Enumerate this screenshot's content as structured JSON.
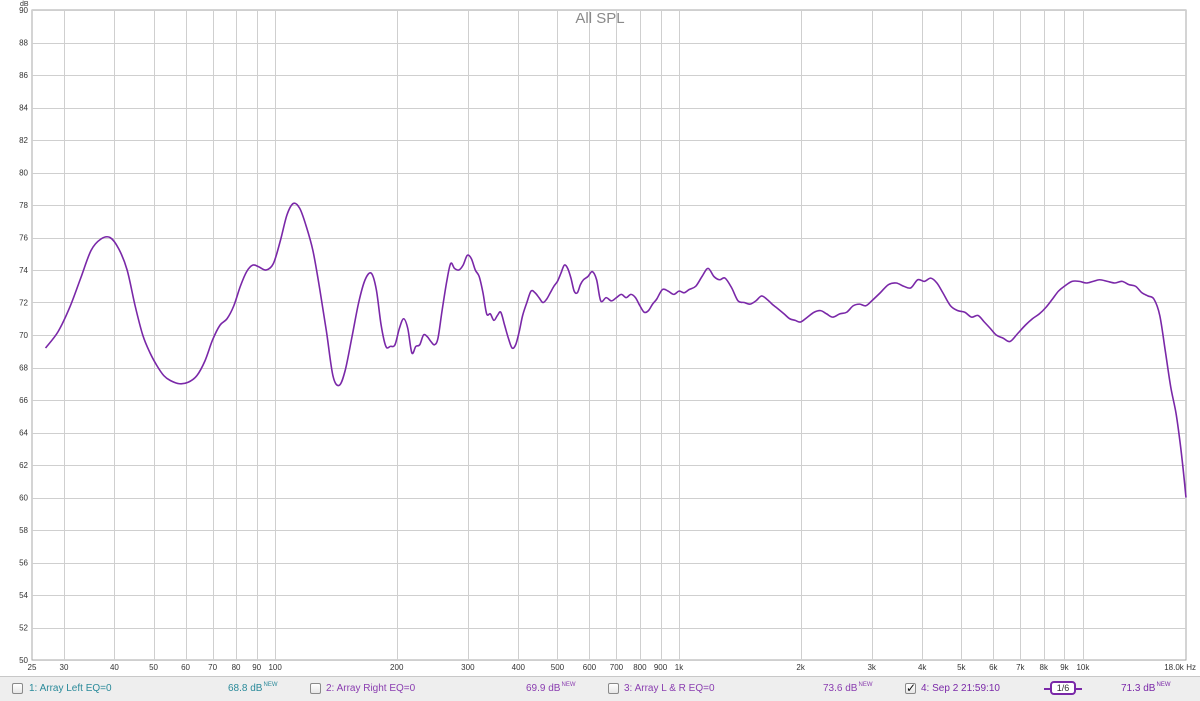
{
  "chart_data": {
    "type": "line",
    "title": "All SPL",
    "ylabel_unit": "dB",
    "xlabel_unit": "Hz",
    "x_scale": "log",
    "xlim": [
      25,
      18000
    ],
    "ylim": [
      50,
      90
    ],
    "y_ticks": [
      50,
      52,
      54,
      56,
      58,
      60,
      62,
      64,
      66,
      68,
      70,
      72,
      74,
      76,
      78,
      80,
      82,
      84,
      86,
      88,
      90
    ],
    "x_ticks": [
      {
        "v": 25,
        "label": "25"
      },
      {
        "v": 30,
        "label": "30"
      },
      {
        "v": 40,
        "label": "40"
      },
      {
        "v": 50,
        "label": "50"
      },
      {
        "v": 60,
        "label": "60"
      },
      {
        "v": 70,
        "label": "70"
      },
      {
        "v": 80,
        "label": "80"
      },
      {
        "v": 90,
        "label": "90"
      },
      {
        "v": 100,
        "label": "100"
      },
      {
        "v": 200,
        "label": "200"
      },
      {
        "v": 300,
        "label": "300"
      },
      {
        "v": 400,
        "label": "400"
      },
      {
        "v": 500,
        "label": "500"
      },
      {
        "v": 600,
        "label": "600"
      },
      {
        "v": 700,
        "label": "700"
      },
      {
        "v": 800,
        "label": "800"
      },
      {
        "v": 900,
        "label": "900"
      },
      {
        "v": 1000,
        "label": "1k"
      },
      {
        "v": 2000,
        "label": "2k"
      },
      {
        "v": 3000,
        "label": "3k"
      },
      {
        "v": 4000,
        "label": "4k"
      },
      {
        "v": 5000,
        "label": "5k"
      },
      {
        "v": 6000,
        "label": "6k"
      },
      {
        "v": 7000,
        "label": "7k"
      },
      {
        "v": 8000,
        "label": "8k"
      },
      {
        "v": 9000,
        "label": "9k"
      },
      {
        "v": 10000,
        "label": "10k"
      },
      {
        "v": 18000,
        "label": "18.0k"
      }
    ],
    "grid": true,
    "series": [
      {
        "name": "4: Sep 2 21:59:10",
        "color": "#7a28a8",
        "points": [
          [
            27,
            69.2
          ],
          [
            29,
            70.2
          ],
          [
            31,
            71.7
          ],
          [
            33,
            73.5
          ],
          [
            35,
            75.2
          ],
          [
            37,
            75.9
          ],
          [
            39,
            76.0
          ],
          [
            41,
            75.3
          ],
          [
            43,
            74.0
          ],
          [
            45,
            71.8
          ],
          [
            47,
            70.0
          ],
          [
            49,
            68.9
          ],
          [
            51,
            68.1
          ],
          [
            53,
            67.5
          ],
          [
            55,
            67.2
          ],
          [
            58,
            67.0
          ],
          [
            61,
            67.1
          ],
          [
            64,
            67.5
          ],
          [
            67,
            68.4
          ],
          [
            70,
            69.7
          ],
          [
            73,
            70.6
          ],
          [
            76,
            71.0
          ],
          [
            79,
            71.8
          ],
          [
            82,
            73.0
          ],
          [
            85,
            73.9
          ],
          [
            88,
            74.3
          ],
          [
            91,
            74.2
          ],
          [
            95,
            74.0
          ],
          [
            99,
            74.4
          ],
          [
            103,
            75.8
          ],
          [
            107,
            77.4
          ],
          [
            111,
            78.1
          ],
          [
            115,
            77.8
          ],
          [
            119,
            76.8
          ],
          [
            124,
            75.2
          ],
          [
            129,
            72.8
          ],
          [
            134,
            70.2
          ],
          [
            139,
            67.5
          ],
          [
            144,
            66.9
          ],
          [
            149,
            67.8
          ],
          [
            155,
            69.9
          ],
          [
            161,
            72.0
          ],
          [
            167,
            73.4
          ],
          [
            173,
            73.8
          ],
          [
            178,
            72.8
          ],
          [
            183,
            70.6
          ],
          [
            188,
            69.3
          ],
          [
            193,
            69.3
          ],
          [
            198,
            69.4
          ],
          [
            203,
            70.4
          ],
          [
            208,
            71.0
          ],
          [
            213,
            70.4
          ],
          [
            218,
            68.9
          ],
          [
            223,
            69.3
          ],
          [
            228,
            69.4
          ],
          [
            233,
            70.0
          ],
          [
            238,
            69.9
          ],
          [
            243,
            69.6
          ],
          [
            248,
            69.4
          ],
          [
            253,
            69.8
          ],
          [
            259,
            71.5
          ],
          [
            266,
            73.3
          ],
          [
            272,
            74.4
          ],
          [
            278,
            74.1
          ],
          [
            285,
            74.0
          ],
          [
            292,
            74.3
          ],
          [
            299,
            74.9
          ],
          [
            306,
            74.7
          ],
          [
            313,
            74.0
          ],
          [
            320,
            73.6
          ],
          [
            327,
            72.6
          ],
          [
            334,
            71.3
          ],
          [
            341,
            71.3
          ],
          [
            348,
            70.9
          ],
          [
            355,
            71.2
          ],
          [
            362,
            71.4
          ],
          [
            370,
            70.6
          ],
          [
            378,
            69.8
          ],
          [
            386,
            69.2
          ],
          [
            394,
            69.4
          ],
          [
            402,
            70.2
          ],
          [
            410,
            71.2
          ],
          [
            420,
            72.0
          ],
          [
            430,
            72.7
          ],
          [
            440,
            72.6
          ],
          [
            450,
            72.3
          ],
          [
            460,
            72.0
          ],
          [
            470,
            72.2
          ],
          [
            480,
            72.6
          ],
          [
            490,
            73.0
          ],
          [
            500,
            73.3
          ],
          [
            510,
            73.8
          ],
          [
            520,
            74.3
          ],
          [
            530,
            74.1
          ],
          [
            540,
            73.5
          ],
          [
            550,
            72.7
          ],
          [
            560,
            72.6
          ],
          [
            570,
            73.1
          ],
          [
            580,
            73.4
          ],
          [
            595,
            73.6
          ],
          [
            610,
            73.9
          ],
          [
            625,
            73.4
          ],
          [
            640,
            72.1
          ],
          [
            660,
            72.3
          ],
          [
            680,
            72.1
          ],
          [
            700,
            72.3
          ],
          [
            720,
            72.5
          ],
          [
            740,
            72.3
          ],
          [
            760,
            72.5
          ],
          [
            780,
            72.3
          ],
          [
            800,
            71.8
          ],
          [
            820,
            71.4
          ],
          [
            840,
            71.5
          ],
          [
            860,
            71.9
          ],
          [
            880,
            72.2
          ],
          [
            910,
            72.8
          ],
          [
            940,
            72.7
          ],
          [
            970,
            72.5
          ],
          [
            1000,
            72.7
          ],
          [
            1030,
            72.6
          ],
          [
            1060,
            72.8
          ],
          [
            1100,
            73.0
          ],
          [
            1140,
            73.6
          ],
          [
            1180,
            74.1
          ],
          [
            1220,
            73.6
          ],
          [
            1260,
            73.4
          ],
          [
            1300,
            73.5
          ],
          [
            1350,
            72.9
          ],
          [
            1400,
            72.1
          ],
          [
            1450,
            72.0
          ],
          [
            1500,
            71.9
          ],
          [
            1550,
            72.1
          ],
          [
            1600,
            72.4
          ],
          [
            1650,
            72.2
          ],
          [
            1700,
            71.9
          ],
          [
            1760,
            71.6
          ],
          [
            1820,
            71.3
          ],
          [
            1880,
            71.0
          ],
          [
            1940,
            70.9
          ],
          [
            2000,
            70.8
          ],
          [
            2080,
            71.1
          ],
          [
            2160,
            71.4
          ],
          [
            2240,
            71.5
          ],
          [
            2320,
            71.3
          ],
          [
            2400,
            71.1
          ],
          [
            2500,
            71.3
          ],
          [
            2600,
            71.4
          ],
          [
            2700,
            71.8
          ],
          [
            2800,
            71.9
          ],
          [
            2900,
            71.8
          ],
          [
            3000,
            72.1
          ],
          [
            3150,
            72.6
          ],
          [
            3300,
            73.1
          ],
          [
            3450,
            73.2
          ],
          [
            3600,
            73.0
          ],
          [
            3750,
            72.9
          ],
          [
            3900,
            73.4
          ],
          [
            4050,
            73.3
          ],
          [
            4200,
            73.5
          ],
          [
            4350,
            73.2
          ],
          [
            4500,
            72.6
          ],
          [
            4700,
            71.8
          ],
          [
            4900,
            71.5
          ],
          [
            5100,
            71.4
          ],
          [
            5300,
            71.1
          ],
          [
            5500,
            71.2
          ],
          [
            5700,
            70.8
          ],
          [
            5900,
            70.4
          ],
          [
            6100,
            70.0
          ],
          [
            6350,
            69.8
          ],
          [
            6600,
            69.6
          ],
          [
            6900,
            70.1
          ],
          [
            7200,
            70.6
          ],
          [
            7500,
            71.0
          ],
          [
            7800,
            71.3
          ],
          [
            8100,
            71.7
          ],
          [
            8400,
            72.2
          ],
          [
            8700,
            72.7
          ],
          [
            9000,
            73.0
          ],
          [
            9400,
            73.3
          ],
          [
            9800,
            73.3
          ],
          [
            10200,
            73.2
          ],
          [
            10600,
            73.3
          ],
          [
            11000,
            73.4
          ],
          [
            11500,
            73.3
          ],
          [
            12000,
            73.2
          ],
          [
            12500,
            73.3
          ],
          [
            13000,
            73.1
          ],
          [
            13500,
            73.0
          ],
          [
            14000,
            72.6
          ],
          [
            14500,
            72.4
          ],
          [
            15000,
            72.2
          ],
          [
            15500,
            71.2
          ],
          [
            16000,
            69.0
          ],
          [
            16500,
            66.8
          ],
          [
            17000,
            65.2
          ],
          [
            17400,
            63.4
          ],
          [
            17700,
            61.8
          ],
          [
            18000,
            60.0
          ]
        ]
      }
    ]
  },
  "legend": [
    {
      "label": "1: Array Left EQ=0",
      "value": "68.8 dB",
      "badge": "NEW",
      "checked": false,
      "color": "#2a8a9a"
    },
    {
      "label": "2: Array Right EQ=0",
      "value": "69.9 dB",
      "badge": "NEW",
      "checked": false,
      "color": "#8a3db0"
    },
    {
      "label": "3: Array L & R EQ=0",
      "value": "73.6 dB",
      "badge": "NEW",
      "checked": false,
      "color": "#8a3db0"
    },
    {
      "label": "4: Sep 2 21:59:10",
      "value": "71.3 dB",
      "badge": "NEW",
      "checked": true,
      "color": "#7a28a8"
    }
  ],
  "smoothing": {
    "numerator": "1",
    "denominator": "6"
  }
}
